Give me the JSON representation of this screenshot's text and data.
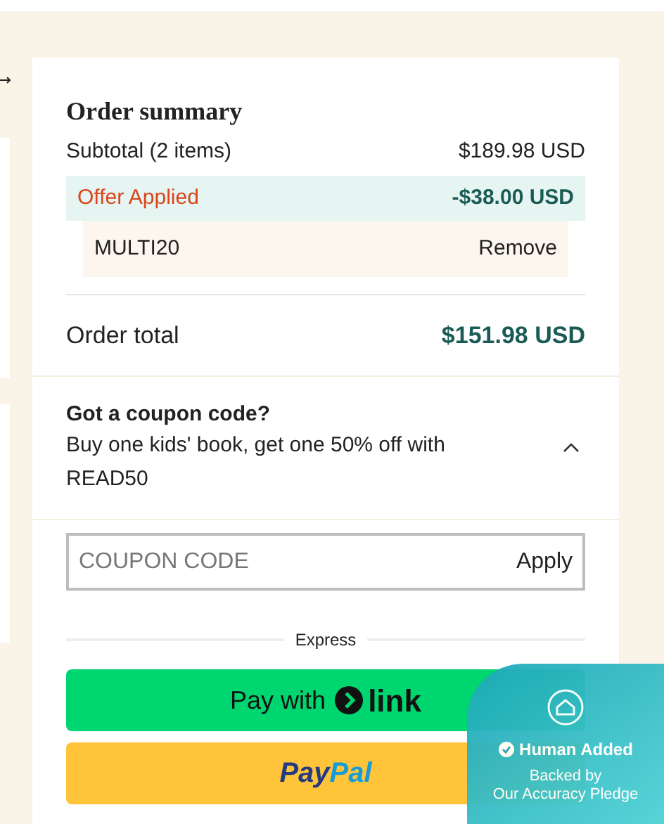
{
  "summary": {
    "title": "Order summary",
    "subtotal_label": "Subtotal (2 items)",
    "subtotal_value": "$189.98 USD",
    "offer_label": "Offer Applied",
    "offer_value": "-$38.00 USD",
    "code": "MULTI20",
    "remove": "Remove",
    "total_label": "Order total",
    "total_value": "$151.98 USD"
  },
  "coupon": {
    "title": "Got a coupon code?",
    "promo": "Buy one kids' book, get one 50% off with READ50",
    "expanded": true,
    "placeholder": "COUPON CODE",
    "apply": "Apply"
  },
  "express": {
    "label": "Express",
    "link_prefix": "Pay with",
    "link_brand": "link",
    "paypal_a": "Pay",
    "paypal_b": "Pal"
  },
  "badge": {
    "title": "Human Added",
    "line_1": "Backed by",
    "line_2": "Our Accuracy Pledge"
  }
}
